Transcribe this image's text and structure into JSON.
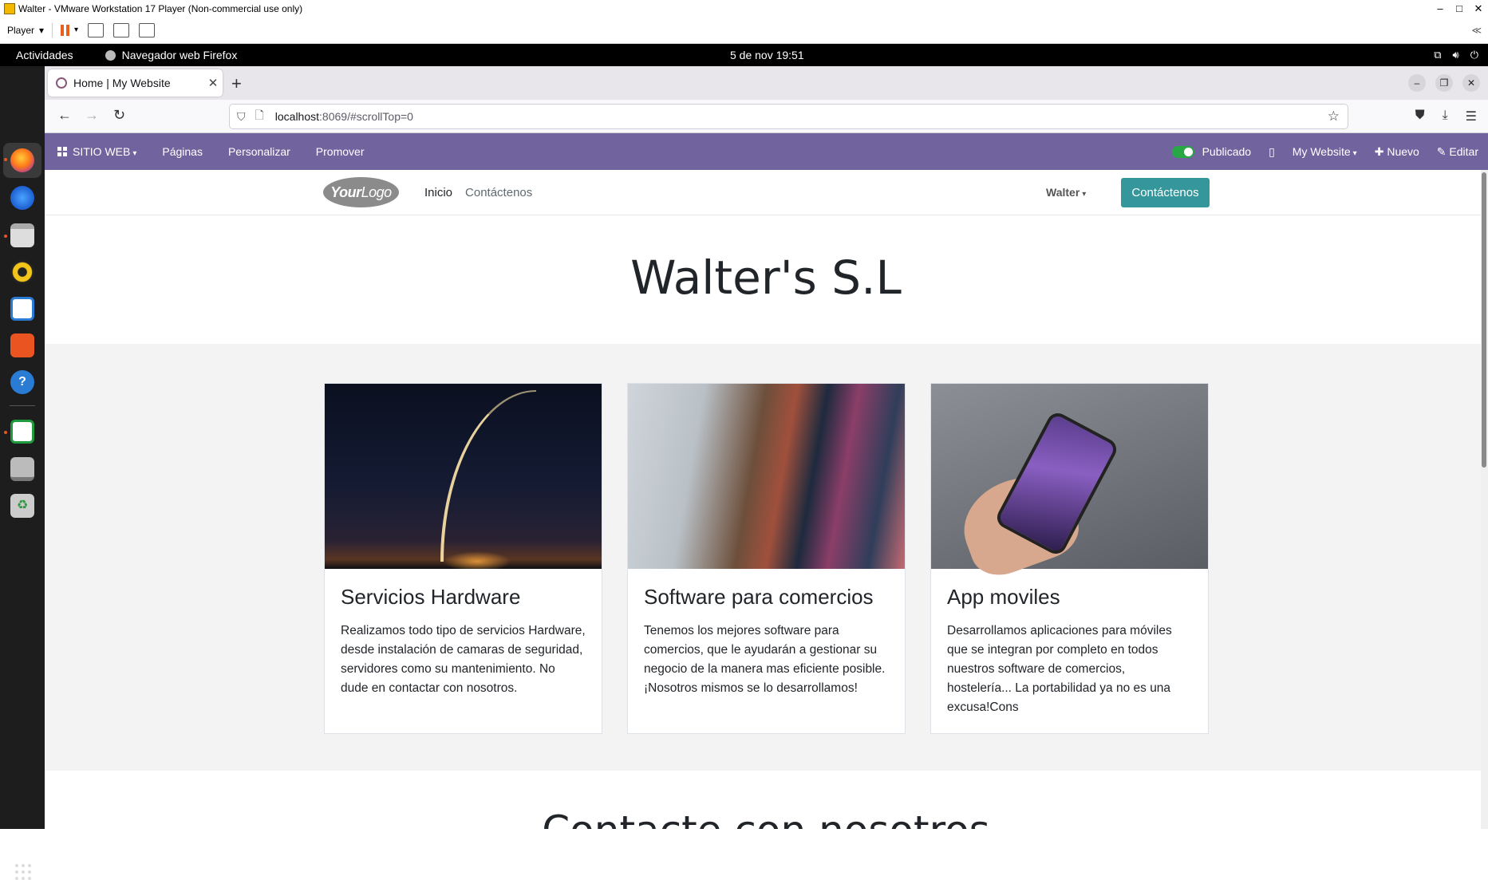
{
  "vmware": {
    "title": "Walter - VMware Workstation 17 Player (Non-commercial use only)",
    "player_label": "Player",
    "collapse": "≪"
  },
  "gnome": {
    "activities": "Actividades",
    "app_name": "Navegador web Firefox",
    "clock": "5 de nov  19:51"
  },
  "firefox": {
    "tab_title": "Home | My Website",
    "url_host": "localhost",
    "url_rest": ":8069/#scrollTop=0"
  },
  "odoo_bar": {
    "website_menu": "SITIO WEB",
    "pages": "Páginas",
    "customize": "Personalizar",
    "promote": "Promover",
    "published": "Publicado",
    "website_select": "My Website",
    "new": "Nuevo",
    "edit": "Editar"
  },
  "site": {
    "logo_your": "Your",
    "logo_logo": "Logo",
    "nav": [
      "Inicio",
      "Contáctenos"
    ],
    "user": "Walter",
    "cta": "Contáctenos",
    "hero_title": "Walter's S.L",
    "cards": [
      {
        "title": "Servicios Hardware",
        "text": "Realizamos todo tipo de servicios Hardware, desde instalación de camaras de seguridad, servidores como su mantenimiento. No dude en contactar con nosotros."
      },
      {
        "title": "Software para comercios",
        "text": "Tenemos los mejores software para comercios, que le ayudarán a gestionar su negocio de la manera mas eficiente posible.¡Nosotros mismos se lo desarrollamos!"
      },
      {
        "title": "App moviles",
        "text": "Desarrollamos aplicaciones para móviles que se integran por completo en todos nuestros software de comercios, hostelería... La portabilidad ya no es una excusa!Cons"
      }
    ],
    "bottom_title": "Contacte con nosotros"
  },
  "colors": {
    "odoo_bar": "#71639e",
    "cta": "#35979c",
    "published_toggle": "#28a745"
  }
}
